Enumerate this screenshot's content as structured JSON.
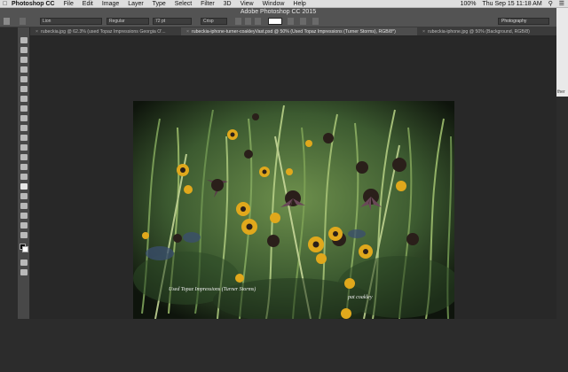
{
  "menubar": {
    "apple": "",
    "items": [
      "Photoshop CC",
      "File",
      "Edit",
      "Image",
      "Layer",
      "Type",
      "Select",
      "Filter",
      "3D",
      "View",
      "Window",
      "Help"
    ],
    "clock": "Thu Sep 15  11:18 AM",
    "battery": "100%"
  },
  "optionsbar": {
    "window_title": "Adobe Photoshop CC 2015",
    "font_family": "Lion",
    "font_style": "Regular",
    "font_size": "72 pt",
    "antialias": "Crisp",
    "workspace": "Photography"
  },
  "tabs": [
    {
      "label": "rubeckia.jpg @ 62.3% (used Topaz Impressions Georgia O'...",
      "active": false
    },
    {
      "label": "rubeckia-iphone-turner-coakleyVast.psd @ 50% (Used Topaz Impressions (Turner Storms), RGB/8*)",
      "active": true
    },
    {
      "label": "rubeckia-iphone.jpg @ 50% (Background, RGB/8)",
      "active": false
    }
  ],
  "document": {
    "caption_left": "Used Topaz Impressions (Turner Storms)",
    "caption_right": "pat coakley"
  },
  "rightpanel": {
    "partial_text": "ther"
  },
  "colors": {
    "flower_petal": "#e0a81c",
    "flower_center": "#2a1f1a",
    "coneflower": "#5a3a4a",
    "foliage": "#3f6a34"
  }
}
